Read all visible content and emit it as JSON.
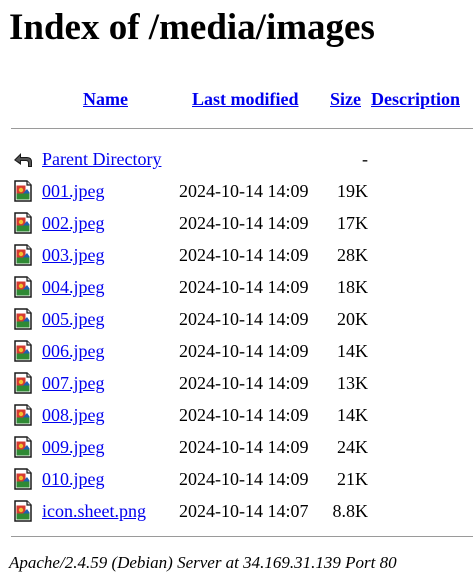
{
  "title": "Index of /media/images",
  "headers": {
    "name": "Name",
    "last_modified": "Last modified",
    "size": "Size",
    "description": "Description"
  },
  "parent": {
    "label": "Parent Directory",
    "size": "-"
  },
  "files": [
    {
      "name": "001.jpeg",
      "modified": "2024-10-14 14:09",
      "size": "19K"
    },
    {
      "name": "002.jpeg",
      "modified": "2024-10-14 14:09",
      "size": "17K"
    },
    {
      "name": "003.jpeg",
      "modified": "2024-10-14 14:09",
      "size": "28K"
    },
    {
      "name": "004.jpeg",
      "modified": "2024-10-14 14:09",
      "size": "18K"
    },
    {
      "name": "005.jpeg",
      "modified": "2024-10-14 14:09",
      "size": "20K"
    },
    {
      "name": "006.jpeg",
      "modified": "2024-10-14 14:09",
      "size": "14K"
    },
    {
      "name": "007.jpeg",
      "modified": "2024-10-14 14:09",
      "size": "13K"
    },
    {
      "name": "008.jpeg",
      "modified": "2024-10-14 14:09",
      "size": "14K"
    },
    {
      "name": "009.jpeg",
      "modified": "2024-10-14 14:09",
      "size": "24K"
    },
    {
      "name": "010.jpeg",
      "modified": "2024-10-14 14:09",
      "size": "21K"
    },
    {
      "name": "icon.sheet.png",
      "modified": "2024-10-14 14:07",
      "size": "8.8K"
    }
  ],
  "footer": "Apache/2.4.59 (Debian) Server at 34.169.31.139 Port 80",
  "icons": {
    "parent": "back-arrow-icon",
    "file": "image-file-icon"
  },
  "colors": {
    "link": "#0000ee",
    "rule": "#9a9a9a"
  }
}
